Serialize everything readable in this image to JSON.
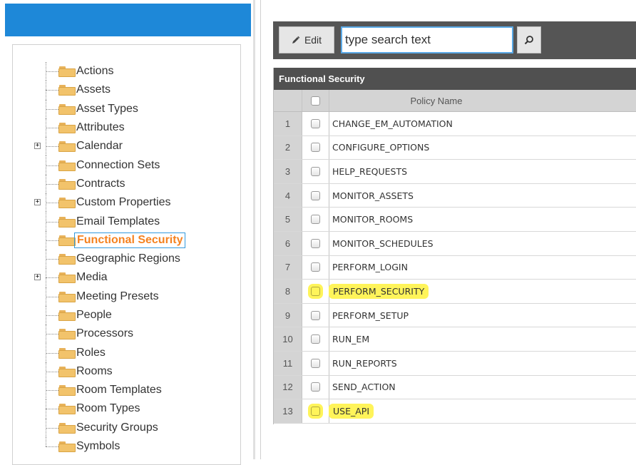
{
  "tree": {
    "items": [
      {
        "label": "Actions",
        "expandable": false,
        "selected": false
      },
      {
        "label": "Assets",
        "expandable": false,
        "selected": false
      },
      {
        "label": "Asset Types",
        "expandable": false,
        "selected": false
      },
      {
        "label": "Attributes",
        "expandable": false,
        "selected": false
      },
      {
        "label": "Calendar",
        "expandable": true,
        "selected": false
      },
      {
        "label": "Connection Sets",
        "expandable": false,
        "selected": false
      },
      {
        "label": "Contracts",
        "expandable": false,
        "selected": false
      },
      {
        "label": "Custom Properties",
        "expandable": true,
        "selected": false
      },
      {
        "label": "Email Templates",
        "expandable": false,
        "selected": false
      },
      {
        "label": "Functional Security",
        "expandable": false,
        "selected": true
      },
      {
        "label": "Geographic Regions",
        "expandable": false,
        "selected": false
      },
      {
        "label": "Media",
        "expandable": true,
        "selected": false
      },
      {
        "label": "Meeting Presets",
        "expandable": false,
        "selected": false
      },
      {
        "label": "People",
        "expandable": false,
        "selected": false
      },
      {
        "label": "Processors",
        "expandable": false,
        "selected": false
      },
      {
        "label": "Roles",
        "expandable": false,
        "selected": false
      },
      {
        "label": "Rooms",
        "expandable": false,
        "selected": false
      },
      {
        "label": "Room Templates",
        "expandable": false,
        "selected": false
      },
      {
        "label": "Room Types",
        "expandable": false,
        "selected": false
      },
      {
        "label": "Security Groups",
        "expandable": false,
        "selected": false
      },
      {
        "label": "Symbols",
        "expandable": false,
        "selected": false
      }
    ],
    "expander_symbol": "+"
  },
  "toolbar": {
    "edit_label": "Edit",
    "search_placeholder": "type search text"
  },
  "grid": {
    "title": "Functional Security",
    "column_header": "Policy Name",
    "rows": [
      {
        "num": "1",
        "name": "CHANGE_EM_AUTOMATION",
        "highlighted": false
      },
      {
        "num": "2",
        "name": "CONFIGURE_OPTIONS",
        "highlighted": false
      },
      {
        "num": "3",
        "name": "HELP_REQUESTS",
        "highlighted": false
      },
      {
        "num": "4",
        "name": "MONITOR_ASSETS",
        "highlighted": false
      },
      {
        "num": "5",
        "name": "MONITOR_ROOMS",
        "highlighted": false
      },
      {
        "num": "6",
        "name": "MONITOR_SCHEDULES",
        "highlighted": false
      },
      {
        "num": "7",
        "name": "PERFORM_LOGIN",
        "highlighted": false
      },
      {
        "num": "8",
        "name": "PERFORM_SECURITY",
        "highlighted": true
      },
      {
        "num": "9",
        "name": "PERFORM_SETUP",
        "highlighted": false
      },
      {
        "num": "10",
        "name": "RUN_EM",
        "highlighted": false
      },
      {
        "num": "11",
        "name": "RUN_REPORTS",
        "highlighted": false
      },
      {
        "num": "12",
        "name": "SEND_ACTION",
        "highlighted": false
      },
      {
        "num": "13",
        "name": "USE_API",
        "highlighted": true
      }
    ]
  },
  "colors": {
    "header_blue": "#1e88d8",
    "selected_text": "#f58220",
    "highlight_yellow": "#fff45a",
    "toolbar_bg": "#555555"
  }
}
